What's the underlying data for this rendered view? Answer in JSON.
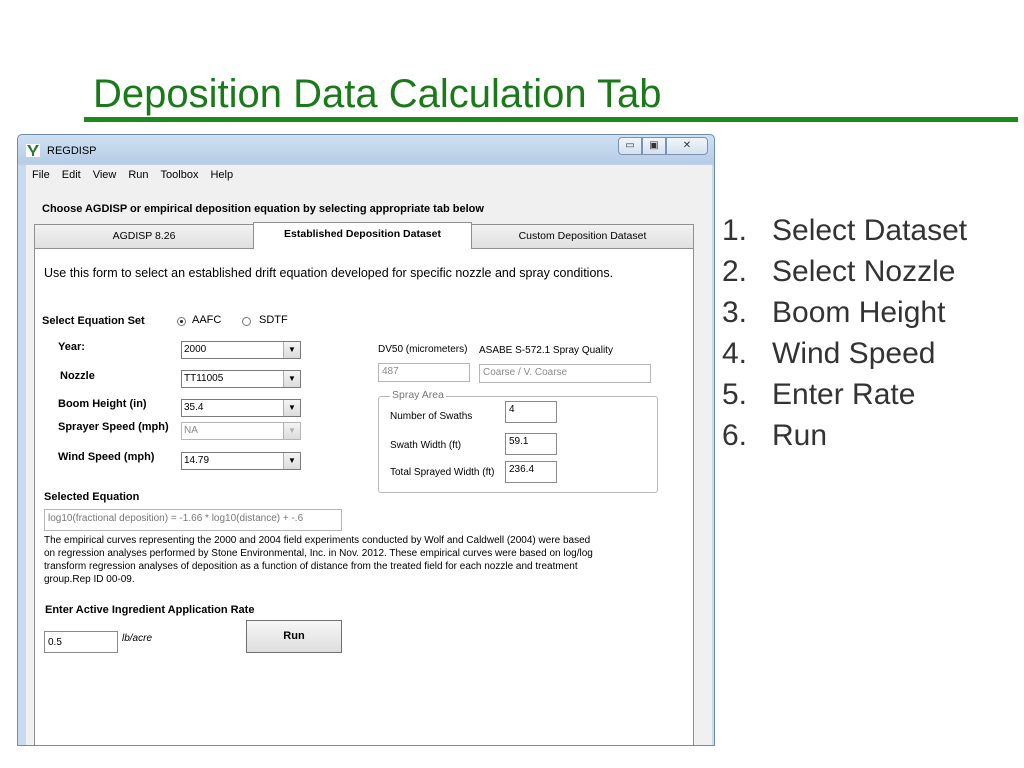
{
  "slide": {
    "title": "Deposition Data Calculation Tab",
    "steps": [
      {
        "num": "1.",
        "text": "Select Dataset"
      },
      {
        "num": "2.",
        "text": "Select Nozzle"
      },
      {
        "num": "3.",
        "text": "Boom Height"
      },
      {
        "num": "4.",
        "text": "Wind Speed"
      },
      {
        "num": "5.",
        "text": "Enter Rate"
      },
      {
        "num": "6.",
        "text": "Run"
      }
    ]
  },
  "window": {
    "title": "REGDISP",
    "controls": {
      "minimize": "▭",
      "maximize": "▣",
      "close": "✕"
    }
  },
  "menu": [
    "File",
    "Edit",
    "View",
    "Run",
    "Toolbox",
    "Help"
  ],
  "choose_label": "Choose AGDISP or empirical deposition equation by selecting appropriate tab below",
  "tabs": [
    {
      "label": "AGDISP 8.26",
      "active": false
    },
    {
      "label": "Established Deposition Dataset",
      "active": true
    },
    {
      "label": "Custom Deposition Dataset",
      "active": false
    }
  ],
  "form": {
    "intro": "Use this form to select an established drift equation developed for specific nozzle and spray conditions.",
    "equation_set_label": "Select Equation Set",
    "equation_set_options": [
      {
        "label": "AAFC",
        "selected": true
      },
      {
        "label": "SDTF",
        "selected": false
      }
    ],
    "fields": {
      "year": {
        "label": "Year:",
        "value": "2000"
      },
      "nozzle": {
        "label": "Nozzle",
        "value": "TT11005"
      },
      "boom_height": {
        "label": "Boom Height (in)",
        "value": "35.4"
      },
      "sprayer_speed": {
        "label": "Sprayer Speed (mph)",
        "value": "NA"
      },
      "wind_speed": {
        "label": "Wind Speed (mph)",
        "value": "14.79"
      }
    },
    "dv50": {
      "label": "DV50 (micrometers)",
      "value": "487"
    },
    "spray_quality": {
      "label": "ASABE S-572.1 Spray Quality",
      "value": "Coarse / V. Coarse"
    },
    "spray_area": {
      "title": "Spray Area",
      "swaths": {
        "label": "Number of Swaths",
        "value": "4"
      },
      "swath_width": {
        "label": "Swath Width (ft)",
        "value": "59.1"
      },
      "total_width": {
        "label": "Total Sprayed Width (ft)",
        "value": "236.4"
      }
    },
    "selected_equation": {
      "label": "Selected Equation",
      "value": "log10(fractional deposition) = -1.66 * log10(distance) + -.6"
    },
    "description_lines": [
      "The empirical curves representing the 2000 and 2004 field experiments conducted by Wolf and Caldwell (2004) were based",
      "on regression analyses performed by Stone Environmental, Inc. in Nov. 2012. These empirical curves were based on log/log",
      "transform regression analyses of deposition as a function of distance from the treated field for each nozzle and treatment",
      "group.Rep ID 00-09."
    ],
    "rate": {
      "label": "Enter Active Ingredient Application Rate",
      "value": "0.5",
      "unit": "lb/acre"
    },
    "run_label": "Run"
  }
}
